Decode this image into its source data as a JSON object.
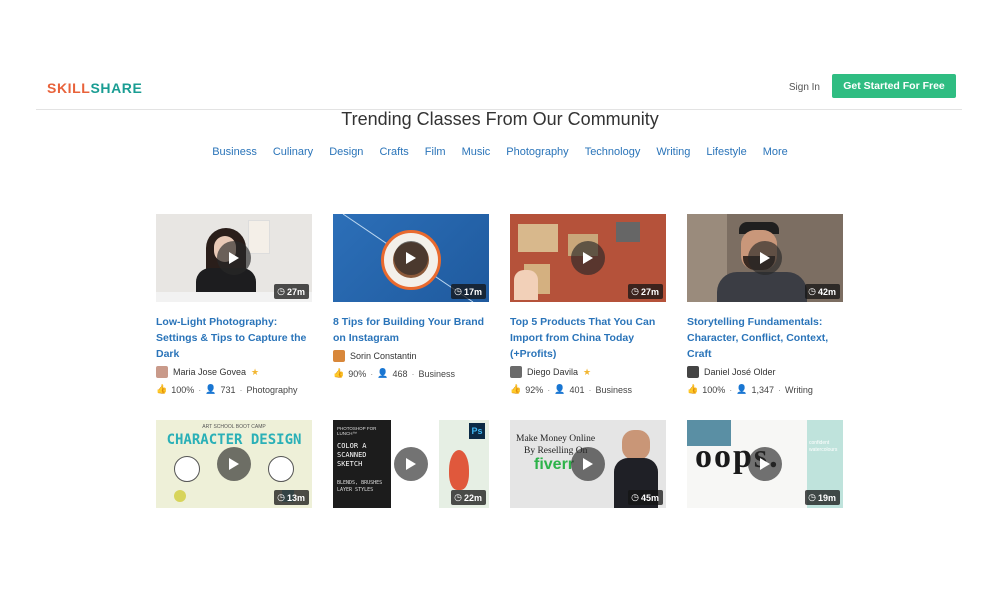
{
  "header": {
    "logo_a": "SKILL",
    "logo_b": "SHARE",
    "signin": "Sign In",
    "cta": "Get Started For Free"
  },
  "title": "Trending Classes From Our Community",
  "categories": [
    "Business",
    "Culinary",
    "Design",
    "Crafts",
    "Film",
    "Music",
    "Photography",
    "Technology",
    "Writing",
    "Lifestyle",
    "More"
  ],
  "cards": [
    {
      "duration": "27m",
      "title": "Low-Light Photography: Settings & Tips to Capture the Dark",
      "author": "Maria Jose Govea",
      "star": "★",
      "likes": "100%",
      "students": "731",
      "category": "Photography"
    },
    {
      "duration": "17m",
      "title": "8 Tips for Building Your Brand on Instagram",
      "author": "Sorin Constantin",
      "star": "",
      "likes": "90%",
      "students": "468",
      "category": "Business"
    },
    {
      "duration": "27m",
      "title": "Top 5 Products That You Can Import from China Today (+Profits)",
      "author": "Diego Davila",
      "star": "★",
      "likes": "92%",
      "students": "401",
      "category": "Business"
    },
    {
      "duration": "42m",
      "title": "Storytelling Fundamentals: Character, Conflict, Context, Craft",
      "author": "Daniel José Older",
      "star": "",
      "likes": "100%",
      "students": "1,347",
      "category": "Writing"
    },
    {
      "duration": "13m",
      "thumb_text_a": "ART SCHOOL BOOT CAMP",
      "thumb_text_b": "CHARACTER DESIGN"
    },
    {
      "duration": "22m",
      "thumb_text_a": "PHOTOSHOP FOR LUNCH™",
      "thumb_text_b": "COLOR A SCANNED SKETCH",
      "thumb_text_c": "BLENDS, BRUSHES LAYER STYLES"
    },
    {
      "duration": "45m",
      "thumb_text_a": "Make Money Online",
      "thumb_text_b": "By Reselling On",
      "thumb_text_c": "fiverr"
    },
    {
      "duration": "19m",
      "thumb_text_a": "oops.",
      "thumb_text_b": "confident watercolours"
    }
  ],
  "colors": {
    "accent": "#2a74b9",
    "cta": "#2fbd82",
    "logo_orange": "#e8623a",
    "logo_teal": "#1a9d93"
  }
}
